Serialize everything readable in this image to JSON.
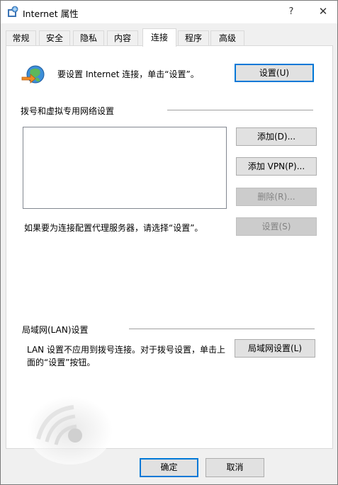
{
  "window": {
    "title": "Internet 属性",
    "help_label": "?",
    "close_label": "✕"
  },
  "tabs": [
    {
      "label": "常规"
    },
    {
      "label": "安全"
    },
    {
      "label": "隐私"
    },
    {
      "label": "内容"
    },
    {
      "label": "连接",
      "active": true
    },
    {
      "label": "程序"
    },
    {
      "label": "高级"
    }
  ],
  "setup": {
    "text": "要设置 Internet 连接，单击“设置”。",
    "button_label": "设置(U)"
  },
  "dialup": {
    "group_label": "拨号和虚拟专用网络设置",
    "add_label": "添加(D)...",
    "add_vpn_label": "添加 VPN(P)...",
    "remove_label": "删除(R)...",
    "settings_label": "设置(S)",
    "proxy_text": "如果要为连接配置代理服务器，请选择“设置”。"
  },
  "lan": {
    "group_label": "局域网(LAN)设置",
    "text": "LAN 设置不应用到拨号连接。对于拨号设置，单击上面的“设置”按钮。",
    "button_label": "局域网设置(L)"
  },
  "footer": {
    "ok_label": "确定",
    "cancel_label": "取消"
  },
  "colors": {
    "accent": "#0078d7"
  }
}
